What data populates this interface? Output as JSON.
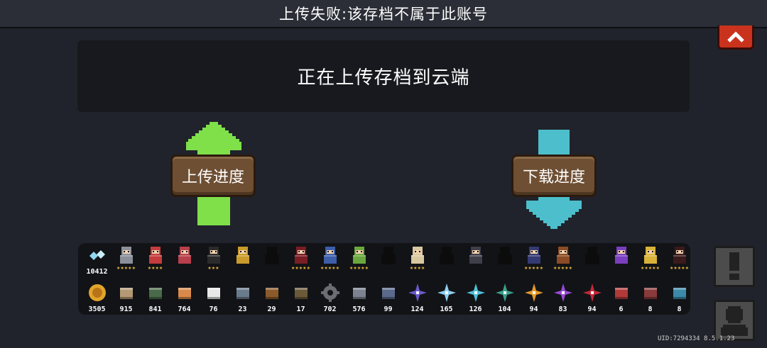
{
  "header": {
    "title": "上传失败:该存档不属于此账号"
  },
  "status_message": "正在上传存档到云端",
  "upload": {
    "label": "上传进度",
    "arrow_color": "#7fe04a"
  },
  "download": {
    "label": "下载进度",
    "arrow_color": "#4dbfcc"
  },
  "uid_text": "UID:7294334 8.5.1.23",
  "inventory": {
    "characters": [
      {
        "icon": "gem-currency-icon",
        "count": "10412",
        "stars": "",
        "color": "#8fd6f0"
      },
      {
        "icon": "knight-icon",
        "count": "",
        "stars": "★★★★★",
        "color": "#8a8f99"
      },
      {
        "icon": "rogue-icon",
        "count": "",
        "stars": "★★★★",
        "color": "#c43c3c"
      },
      {
        "icon": "witch-icon",
        "count": "",
        "stars": "",
        "color": "#b83f4c"
      },
      {
        "icon": "assassin-icon",
        "count": "",
        "stars": "★★★",
        "color": "#2b2b2b"
      },
      {
        "icon": "engineer-icon",
        "count": "",
        "stars": "",
        "color": "#c99b2b"
      },
      {
        "icon": "locked-hero-icon",
        "count": "",
        "stars": "",
        "color": "#0c0c0c"
      },
      {
        "icon": "vampire-icon",
        "count": "",
        "stars": "★★★★★",
        "color": "#7a1d24"
      },
      {
        "icon": "paladin-icon",
        "count": "",
        "stars": "★★★★★",
        "color": "#3d5ea8"
      },
      {
        "icon": "elf-icon",
        "count": "",
        "stars": "★★★★★",
        "color": "#6aa83f"
      },
      {
        "icon": "locked-hero-icon",
        "count": "",
        "stars": "",
        "color": "#0c0c0c"
      },
      {
        "icon": "priest-icon",
        "count": "",
        "stars": "★★★★",
        "color": "#d8c8a0"
      },
      {
        "icon": "locked-hero-icon",
        "count": "",
        "stars": "",
        "color": "#0c0c0c"
      },
      {
        "icon": "necromancer-icon",
        "count": "",
        "stars": "",
        "color": "#3f3f4a"
      },
      {
        "icon": "locked-hero-icon",
        "count": "",
        "stars": "",
        "color": "#0c0c0c"
      },
      {
        "icon": "werewolf-icon",
        "count": "",
        "stars": "★★★★★",
        "color": "#343a72"
      },
      {
        "icon": "officer-icon",
        "count": "",
        "stars": "★★★★★",
        "color": "#8b4b24"
      },
      {
        "icon": "locked-hero-icon",
        "count": "",
        "stars": "",
        "color": "#0c0c0c"
      },
      {
        "icon": "wizard-icon",
        "count": "",
        "stars": "",
        "color": "#7a3fbf"
      },
      {
        "icon": "golden-knight-icon",
        "count": "",
        "stars": "★★★★★",
        "color": "#d9b23a"
      },
      {
        "icon": "berserker-icon",
        "count": "",
        "stars": "★★★★★",
        "color": "#3a1a1a"
      }
    ],
    "materials": [
      {
        "icon": "gold-coin-icon",
        "count": "3505",
        "color": "#e2a528"
      },
      {
        "icon": "wood-plank-icon",
        "count": "915",
        "color": "#b49a74"
      },
      {
        "icon": "green-crate-icon",
        "count": "841",
        "color": "#4a6b4a"
      },
      {
        "icon": "meat-icon",
        "count": "764",
        "color": "#d98a4a"
      },
      {
        "icon": "sack-icon",
        "count": "76",
        "color": "#e8e8e8"
      },
      {
        "icon": "gem-disc-icon",
        "count": "23",
        "color": "#6a7b8c"
      },
      {
        "icon": "hammer-icon",
        "count": "29",
        "color": "#8a5a2a"
      },
      {
        "icon": "fish-icon",
        "count": "17",
        "color": "#6b5a3a"
      },
      {
        "icon": "gear-icon",
        "count": "702",
        "color": "#6c6c74"
      },
      {
        "icon": "ore-icon",
        "count": "576",
        "color": "#7c8290"
      },
      {
        "icon": "fur-icon",
        "count": "99",
        "color": "#5a6a8c"
      },
      {
        "icon": "crystal-purple-icon",
        "count": "124",
        "color": "#6a5acd"
      },
      {
        "icon": "crystal-blue-icon",
        "count": "165",
        "color": "#8ecff0"
      },
      {
        "icon": "crystal-cyan-icon",
        "count": "126",
        "color": "#4ec0d8"
      },
      {
        "icon": "crystal-teal-icon",
        "count": "104",
        "color": "#3aa08c"
      },
      {
        "icon": "crystal-orange-icon",
        "count": "94",
        "color": "#e89a2a"
      },
      {
        "icon": "crystal-violet-icon",
        "count": "83",
        "color": "#9a4ad8"
      },
      {
        "icon": "crystal-red-icon",
        "count": "94",
        "color": "#c02a3a"
      },
      {
        "icon": "red-device-icon",
        "count": "6",
        "color": "#b03a3a"
      },
      {
        "icon": "totem-icon",
        "count": "8",
        "color": "#8a3a3a"
      },
      {
        "icon": "blue-device-icon",
        "count": "8",
        "color": "#3a8aa8"
      }
    ]
  }
}
